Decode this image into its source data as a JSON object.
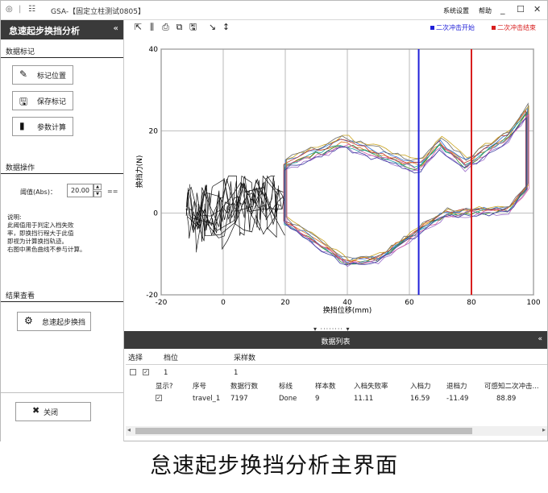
{
  "window": {
    "app_name": "GSA-",
    "doc_title": "【固定立柱测试0805】",
    "menu_settings": "系统设置",
    "menu_help": "帮助"
  },
  "sidebar": {
    "title": "怠速起步换挡分析",
    "collapse_glyph": "«",
    "data_mark": {
      "title": "数据标记",
      "mark_position": "标记位置",
      "save_mark": "保存标记",
      "param_calc": "参数计算"
    },
    "data_operation": {
      "title": "数据操作",
      "threshold_label": "阈值(Abs)：",
      "threshold_value": "20.00",
      "threshold_unit": "==",
      "description_lines": [
        "说明:",
        "此阈值用于判定入档失败",
        "率，即换挡行程大于此值",
        "即视为计算换挡轨迹。",
        "右图中黑色曲线不参与计算。"
      ]
    },
    "result_view": {
      "title": "结果查看",
      "idle_shift": "怠速起步换挡"
    },
    "close_label": "关闭"
  },
  "toolbar": {
    "icons": [
      "cursor-icon",
      "bars-icon",
      "print-icon",
      "copy-icon",
      "save-icon",
      "draw-icon",
      "measure-icon"
    ],
    "legend_start": "二次冲击开始",
    "legend_end": "二次冲击结束",
    "legend_start_color": "#1f1fd8",
    "legend_end_color": "#d81f1f"
  },
  "chart_data": {
    "type": "line",
    "title": "",
    "xlabel": "换挡位移(mm)",
    "ylabel": "换挡力(N)",
    "xlim": [
      -20,
      100
    ],
    "ylim": [
      -20,
      40
    ],
    "xticks": [
      "-20",
      "0",
      "20",
      "40",
      "60",
      "80",
      "100"
    ],
    "yticks": [
      "-20",
      "0",
      "20",
      "40"
    ],
    "grid": true,
    "vlines": [
      {
        "x": 63,
        "color": "#1f1fd8",
        "label": "二次冲击开始"
      },
      {
        "x": 80,
        "color": "#d81f1f",
        "label": "二次冲击结束"
      }
    ],
    "colors": {
      "excluded": "#111111",
      "series": [
        "#e0741a",
        "#2a8a2a",
        "#2a6fd6",
        "#1aa0a0",
        "#c0392b",
        "#9a6cc9",
        "#c9a21a",
        "#6c6c6c",
        "#d65ca0",
        "#3a3aa0"
      ]
    }
  },
  "list": {
    "title": "数据列表",
    "collapse_glyph": "«",
    "columns": [
      "选择",
      "档位",
      "采样数"
    ],
    "group_row": {
      "gear": "1",
      "samples": "1"
    },
    "sub_columns": [
      "显示?",
      "序号",
      "数据行数",
      "标线",
      "样本数",
      "入档失败率",
      "入档力",
      "退档力",
      "可感知二次冲击..."
    ],
    "rows": [
      {
        "show": "✓",
        "id": "travel_1",
        "rows": "7197",
        "mark": "Done",
        "samples": "9",
        "fail_rate": "11.11",
        "in_force": "16.59",
        "out_force": "-11.49",
        "impact": "88.89"
      }
    ]
  },
  "caption": "怠速起步换挡分析主界面"
}
